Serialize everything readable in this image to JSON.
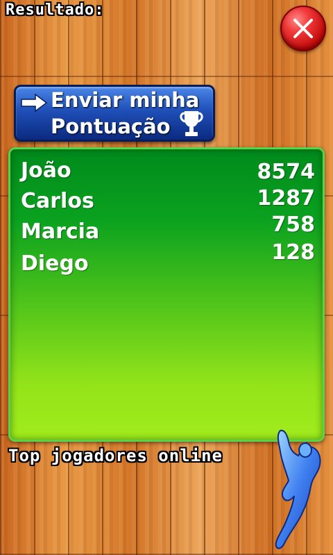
{
  "header": {
    "title": "Resultado:",
    "close_icon": "close-icon"
  },
  "submit_button": {
    "line1": "Enviar minha",
    "line2": "Pontuação",
    "icons": [
      "arrow-right-icon",
      "trophy-icon"
    ]
  },
  "scores": [
    {
      "name": "João",
      "score": "8574"
    },
    {
      "name": "Carlos",
      "score": "1287"
    },
    {
      "name": "Marcia",
      "score": "758"
    },
    {
      "name": "Diego",
      "score": "128"
    }
  ],
  "footer": {
    "label": "Top jogadores online"
  },
  "colors": {
    "panel_top": "#008a1c",
    "panel_bottom": "#a2ec1c",
    "button_blue": "#1f4fb8",
    "close_red": "#d41a1a"
  }
}
